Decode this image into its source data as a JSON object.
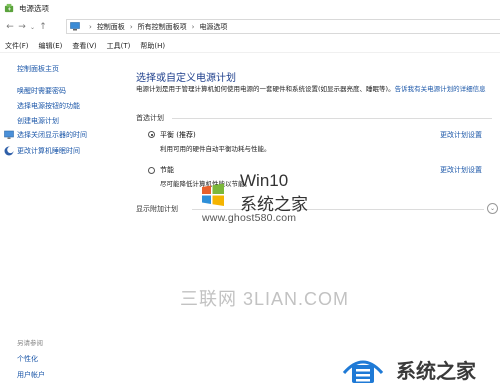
{
  "window": {
    "title": "电源选项"
  },
  "address": {
    "crumbs": [
      "控制面板",
      "所有控制面板项",
      "电源选项"
    ],
    "separator": "›"
  },
  "menu": [
    "文件(F)",
    "编辑(E)",
    "查看(V)",
    "工具(T)",
    "帮助(H)"
  ],
  "sidebar": {
    "home": "控制面板主页",
    "items": [
      {
        "label": "唤醒时需要密码"
      },
      {
        "label": "选择电源按钮的功能"
      },
      {
        "label": "创建电源计划"
      },
      {
        "label": "选择关闭显示器的时间"
      },
      {
        "label": "更改计算机睡眠时间"
      }
    ],
    "see_also_title": "另请参阅",
    "see_also": [
      "个性化",
      "用户帐户"
    ]
  },
  "main": {
    "heading": "选择或自定义电源计划",
    "description": "电源计划是用于管理计算机如何使用电源的一套硬件和系统设置(如显示器亮度、睡眠等)。",
    "description_link": "告诉我有关电源计划的详细信息",
    "preferred_title": "首选计划",
    "plans": [
      {
        "name": "平衡 (推荐)",
        "desc": "利用可用的硬件自动平衡功耗与性能。",
        "selected": true,
        "change": "更改计划设置"
      },
      {
        "name": "节能",
        "desc": "尽可能降低计算机性能以节能。",
        "selected": false,
        "change": "更改计划设置"
      }
    ],
    "extra_title": "显示附加计划"
  },
  "watermarks": {
    "brand1_line1": "Win10",
    "brand1_line2": "系统之家",
    "brand1_url": "www.ghost580.com",
    "brand2": "三联网 3LIAN.COM",
    "brand3": "系统之家"
  },
  "colors": {
    "link": "#1a56a8",
    "heading": "#1e3f8c",
    "background": "#ffffff"
  }
}
